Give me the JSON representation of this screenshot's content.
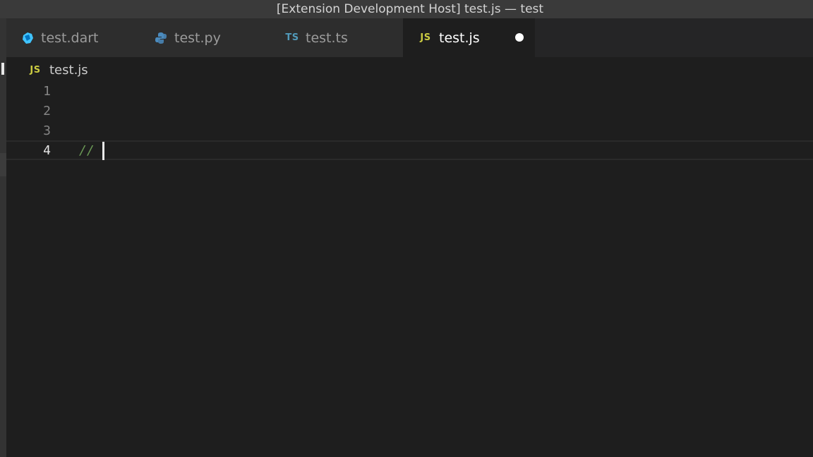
{
  "window": {
    "title": "[Extension Development Host] test.js — test"
  },
  "tabs": [
    {
      "label": "test.dart",
      "icon": "dart-icon",
      "active": false
    },
    {
      "label": "test.py",
      "icon": "python-icon",
      "active": false
    },
    {
      "label": "test.ts",
      "icon": "typescript-icon",
      "icon_text": "TS",
      "active": false
    },
    {
      "label": "test.js",
      "icon": "javascript-icon",
      "icon_text": "JS",
      "active": true,
      "dirty": true
    }
  ],
  "breadcrumb": {
    "icon_text": "JS",
    "file": "test.js"
  },
  "editor": {
    "lines": [
      {
        "number": "1",
        "text": ""
      },
      {
        "number": "2",
        "text": ""
      },
      {
        "number": "3",
        "text": ""
      },
      {
        "number": "4",
        "text": "//"
      }
    ],
    "current_line": 4
  },
  "colors": {
    "background": "#1e1e1e",
    "tab_inactive": "#2d2d2d",
    "comment": "#6a9955",
    "ts_icon": "#519aba",
    "js_icon": "#cbcb41",
    "dart_icon": "#40c4ff",
    "python_icon": "#4b8bbe"
  }
}
